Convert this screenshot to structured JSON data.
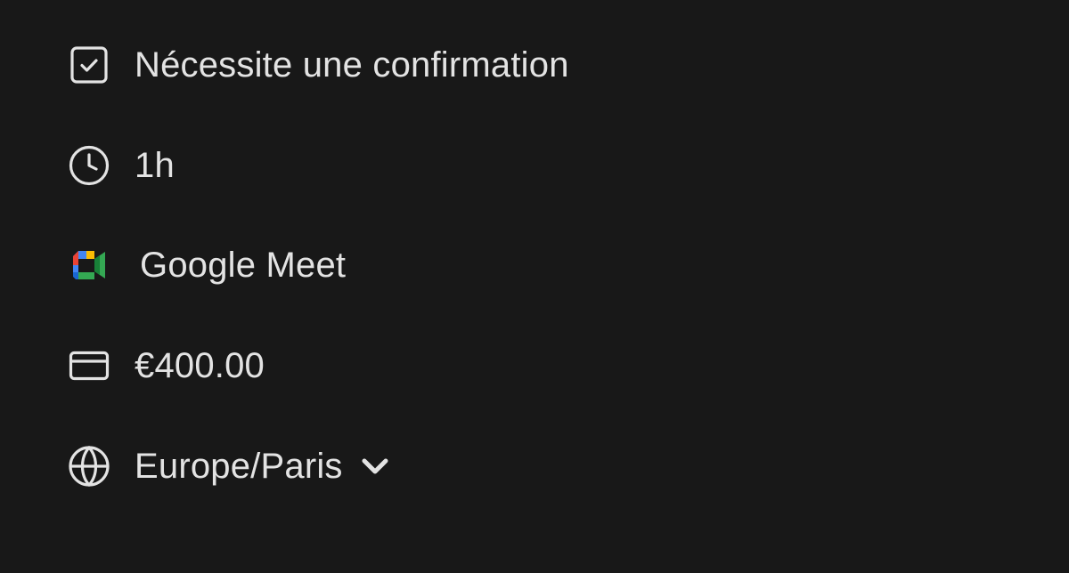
{
  "details": {
    "confirmation": {
      "icon": "checkbox-check-icon",
      "label": "Nécessite une confirmation"
    },
    "duration": {
      "icon": "clock-icon",
      "label": "1h"
    },
    "location": {
      "icon": "google-meet-icon",
      "label": "Google Meet"
    },
    "price": {
      "icon": "credit-card-icon",
      "label": "€400.00"
    },
    "timezone": {
      "icon": "globe-icon",
      "label": "Europe/Paris",
      "chevron_icon": "chevron-down-icon"
    }
  },
  "colors": {
    "background": "#181818",
    "text": "#e3e3e3",
    "icon": "#e3e3e3",
    "meet_blue": "#4285F4",
    "meet_red": "#EA4335",
    "meet_yellow": "#FBBC04",
    "meet_green": "#34A853",
    "meet_dark_green": "#188038"
  }
}
